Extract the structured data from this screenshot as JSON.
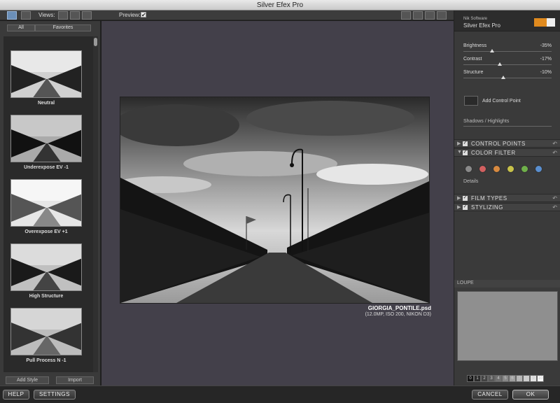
{
  "window": {
    "title": "Silver Efex Pro"
  },
  "toolbar": {
    "views_label": "Views:",
    "preview_label": "Preview:",
    "preview_checked": "✔"
  },
  "left_panel": {
    "tabs": [
      "All",
      "Favorites"
    ],
    "presets": [
      {
        "label": "Neutral"
      },
      {
        "label": "Underexpose EV -1"
      },
      {
        "label": "Overexpose EV +1"
      },
      {
        "label": "High Structure"
      },
      {
        "label": "Pull Process N -1"
      }
    ],
    "add_style": "Add Style",
    "import": "Import"
  },
  "image": {
    "filename": "GIORGIA_PONTILE.psd",
    "meta": "(12.0MP, ISO 200, NIKON D3)"
  },
  "right_panel": {
    "company": "Nik Software",
    "product": "Silver Efex Pro",
    "sliders": [
      {
        "name": "Brightness",
        "value": "-35%",
        "level": -0.35
      },
      {
        "name": "Contrast",
        "value": "-17%",
        "level": -0.17
      },
      {
        "name": "Structure",
        "value": "-10%",
        "level": -0.1
      }
    ],
    "add_control_point": "Add Control Point",
    "shadows_highlights": "Shadows / Highlights",
    "sections": {
      "control_points": "CONTROL POINTS",
      "color_filter": "COLOR FILTER",
      "film_types": "FILM TYPES",
      "stylizing": "STYLIZING"
    },
    "filter_colors": [
      "#8a8a8a",
      "#d26060",
      "#d88a40",
      "#c8c24a",
      "#6fb04a",
      "#5a8fd0"
    ],
    "details_label": "Details",
    "loupe_label": "LOUPE",
    "zone_labels": [
      "0",
      "1",
      "2",
      "3",
      "4",
      "5",
      "6",
      "7",
      "8",
      "9",
      "10"
    ]
  },
  "bottom_bar": {
    "help": "HELP",
    "settings": "SETTINGS",
    "cancel": "CANCEL",
    "ok": "OK"
  }
}
